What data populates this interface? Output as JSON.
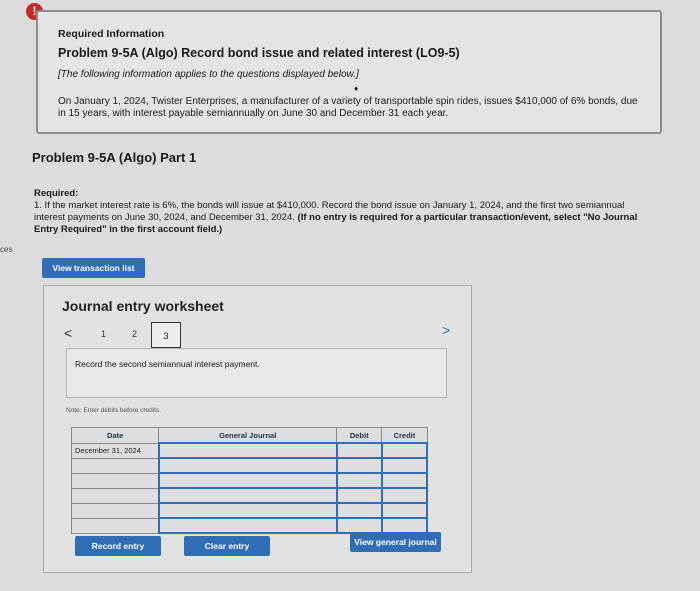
{
  "alert": {
    "glyph": "!"
  },
  "info": {
    "title": "Required Information",
    "problem": "Problem 9-5A (Algo) Record bond issue and related interest (LO9-5)",
    "note": "[The following information applies to the questions displayed below.]",
    "arrow": "♦",
    "body": "On January 1, 2024, Twister Enterprises, a manufacturer of a variety of transportable spin rides, issues $410,000 of 6% bonds, due in 15 years, with interest payable semiannually on June 30 and December 31 each year."
  },
  "part": {
    "title": "Problem 9-5A (Algo) Part 1"
  },
  "required": {
    "heading": "Required:",
    "text": "1. If the market interest rate is 6%, the bonds will issue at $410,000. Record the bond issue on January 1, 2024, and the first two semiannual interest payments on June 30, 2024, and December 31, 2024.",
    "bold_text": "(If no entry is required for a particular transaction/event, select \"No Journal Entry Required\" in the first account field.)"
  },
  "side_label": "ces",
  "buttons": {
    "view_transaction_list": "View transaction list",
    "record_entry": "Record entry",
    "clear_entry": "Clear entry",
    "view_general_journal": "View general journal"
  },
  "worksheet": {
    "title": "Journal entry worksheet",
    "prev": "<",
    "next": ">",
    "pages": [
      "1",
      "2",
      "3"
    ],
    "active_page": "3",
    "description": "Record the second semiannual interest payment.",
    "note": "Note: Enter debits before credits."
  },
  "table": {
    "headers": {
      "date": "Date",
      "account": "General Journal",
      "debit": "Debit",
      "credit": "Credit"
    },
    "date_value": "December 31, 2024"
  }
}
